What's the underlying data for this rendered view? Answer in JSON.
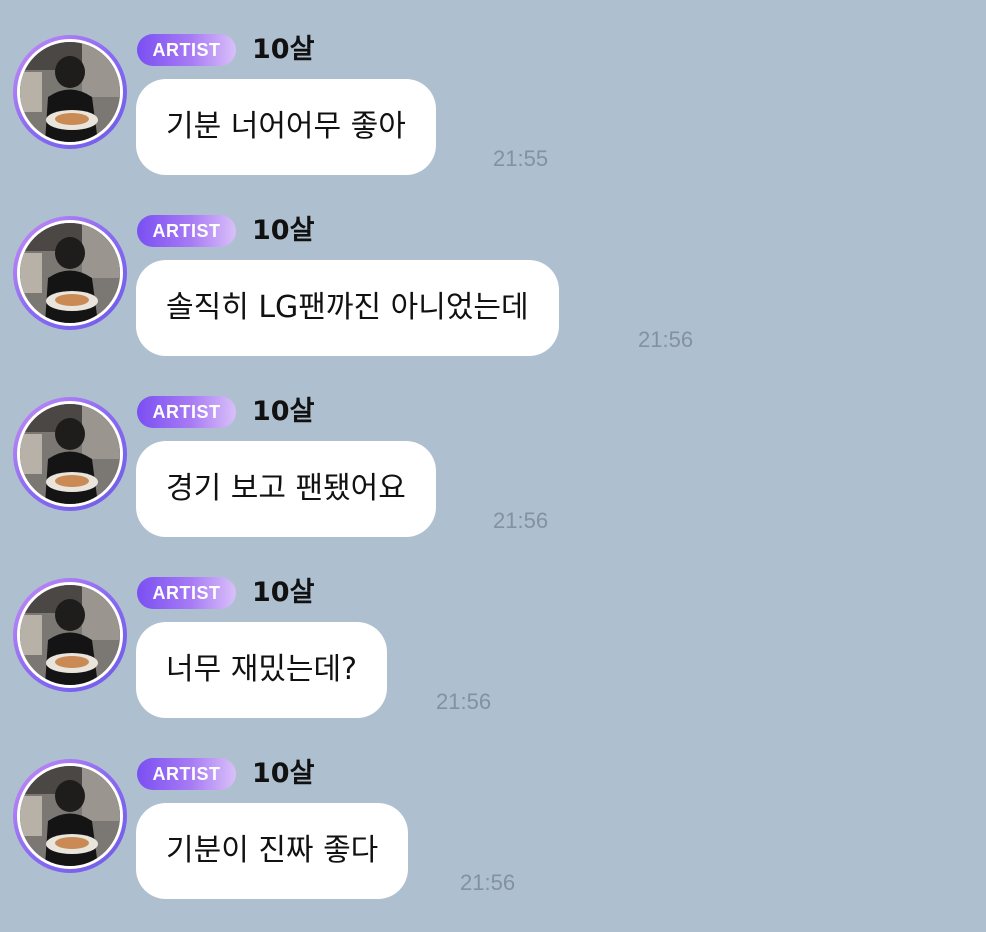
{
  "chat": {
    "messages": [
      {
        "badge": "ARTIST",
        "sender": "10살",
        "text": "기분 너어어무 좋아",
        "time": "21:55"
      },
      {
        "badge": "ARTIST",
        "sender": "10살",
        "text": "솔직히 LG팬까진 아니었는데",
        "time": "21:56"
      },
      {
        "badge": "ARTIST",
        "sender": "10살",
        "text": "경기 보고 팬됐어요",
        "time": "21:56"
      },
      {
        "badge": "ARTIST",
        "sender": "10살",
        "text": "너무 재밌는데?",
        "time": "21:56"
      },
      {
        "badge": "ARTIST",
        "sender": "10살",
        "text": "기분이 진짜 좋다",
        "time": "21:56"
      }
    ]
  }
}
